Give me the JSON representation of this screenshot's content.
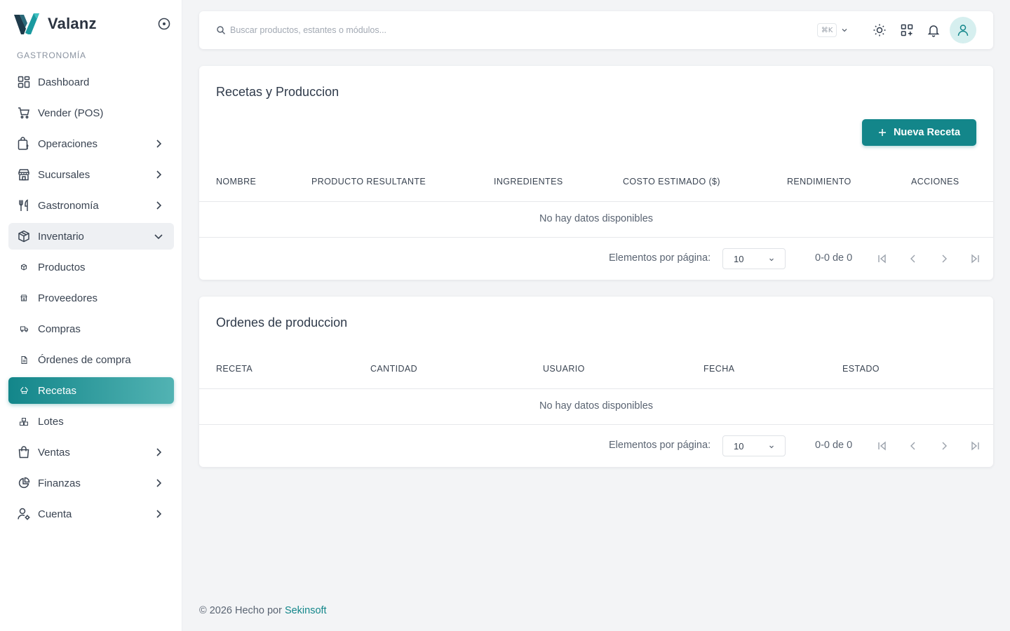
{
  "brand": {
    "name": "Valanz"
  },
  "sidebar": {
    "section": "GASTRONOMÍA",
    "items": [
      {
        "label": "Dashboard",
        "icon": "dashboard-icon"
      },
      {
        "label": "Vender (POS)",
        "icon": "cart-icon"
      },
      {
        "label": "Operaciones",
        "icon": "operations-icon"
      },
      {
        "label": "Sucursales",
        "icon": "store-icon"
      },
      {
        "label": "Gastronomía",
        "icon": "utensils-icon"
      },
      {
        "label": "Inventario",
        "icon": "box-icon"
      },
      {
        "label": "Productos",
        "icon": "dot-box-icon"
      },
      {
        "label": "Proveedores",
        "icon": "dot-store-icon"
      },
      {
        "label": "Compras",
        "icon": "dot-truck-icon"
      },
      {
        "label": "Órdenes de compra",
        "icon": "dot-file-icon"
      },
      {
        "label": "Recetas",
        "icon": "chef-hat-icon"
      },
      {
        "label": "Lotes",
        "icon": "boxes-icon"
      },
      {
        "label": "Ventas",
        "icon": "bag-icon"
      },
      {
        "label": "Finanzas",
        "icon": "pie-chart-icon"
      },
      {
        "label": "Cuenta",
        "icon": "user-gear-icon"
      }
    ]
  },
  "topbar": {
    "search_placeholder": "Buscar productos, estantes o módulos...",
    "shortcut": "⌘K"
  },
  "recipes": {
    "title": "Recetas y Produccion",
    "new_button": "Nueva Receta",
    "columns": [
      "NOMBRE",
      "PRODUCTO RESULTANTE",
      "INGREDIENTES",
      "COSTO ESTIMADO ($)",
      "RENDIMIENTO",
      "ACCIONES"
    ],
    "empty": "No hay datos disponibles",
    "per_page_label": "Elementos por página:",
    "per_page": "10",
    "range": "0-0 de 0"
  },
  "orders": {
    "title": "Ordenes de produccion",
    "columns": [
      "RECETA",
      "CANTIDAD",
      "USUARIO",
      "FECHA",
      "ESTADO"
    ],
    "empty": "No hay datos disponibles",
    "per_page_label": "Elementos por página:",
    "per_page": "10",
    "range": "0-0 de 0"
  },
  "footer": {
    "text": "© 2026 Hecho por ",
    "link": "Sekinsoft"
  },
  "colors": {
    "accent": "#13868a",
    "accent_light": "#52b3b3",
    "background": "#f3f4f6"
  }
}
